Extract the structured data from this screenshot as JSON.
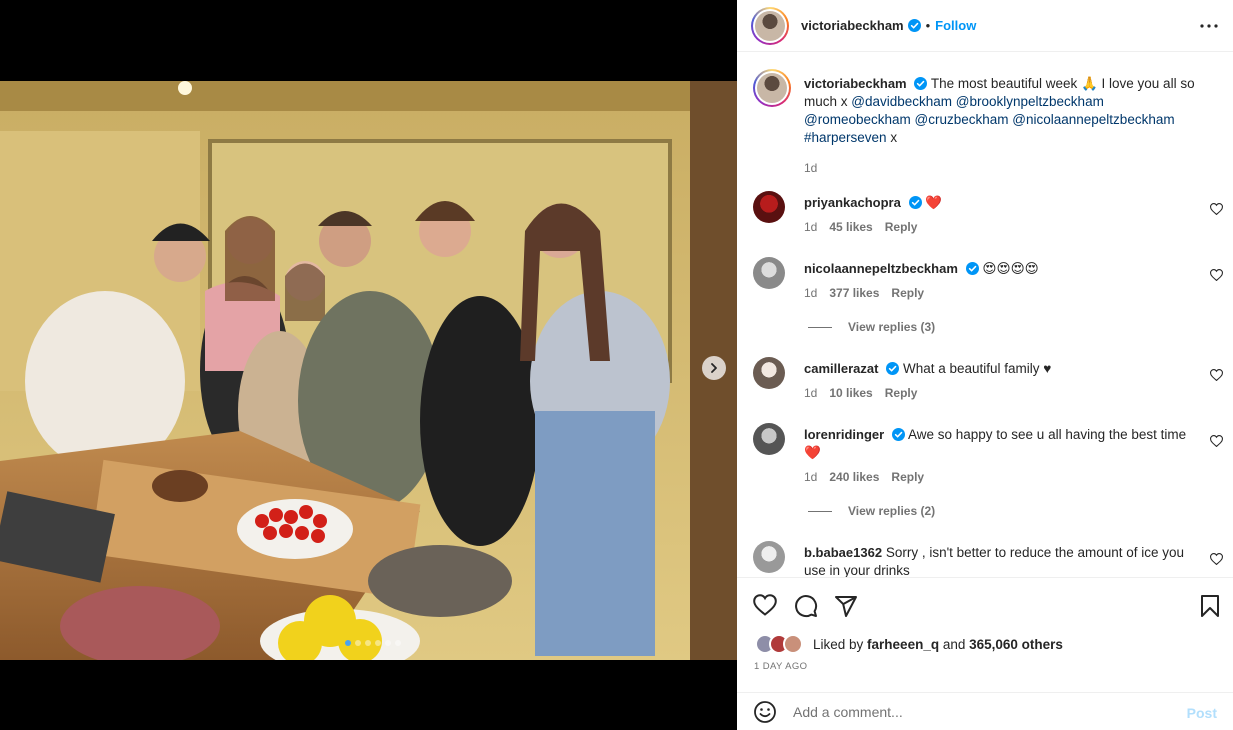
{
  "post": {
    "author": "victoriabeckham",
    "follow_label": "Follow",
    "separator": "•"
  },
  "caption": {
    "username": "victoriabeckham",
    "text_1": "The most beautiful week 🙏 I love you all so much x ",
    "mentions": [
      "@davidbeckham",
      "@brooklynpeltzbeckham",
      "@romeobeckham",
      "@cruzbeckham",
      "@nicolaannepeltzbeckham",
      "#harperseven"
    ],
    "text_end": " x",
    "time": "1d"
  },
  "comments": [
    {
      "username": "priyankachopra",
      "text": "❤️",
      "time": "1d",
      "likes": "45 likes",
      "reply": "Reply"
    },
    {
      "username": "nicolaannepeltzbeckham",
      "text": "😍😍😍😍",
      "time": "1d",
      "likes": "377 likes",
      "reply": "Reply",
      "view_replies": "View replies (3)"
    },
    {
      "username": "camillerazat",
      "text": "What a beautiful family ♥",
      "time": "1d",
      "likes": "10 likes",
      "reply": "Reply"
    },
    {
      "username": "lorenridinger",
      "text": "Awe so happy to see u all having the best time ❤️",
      "time": "1d",
      "likes": "240 likes",
      "reply": "Reply",
      "view_replies": "View replies (2)"
    },
    {
      "username": "b.babae1362",
      "text": "Sorry , isn't better to reduce the amount of ice you use in your drinks"
    }
  ],
  "likes": {
    "prefix": "Liked by ",
    "user": "farheeen_q",
    "middle": " and ",
    "count": "365,060 others"
  },
  "posted": "1 DAY AGO",
  "composer": {
    "placeholder": "Add a comment...",
    "post_label": "Post"
  },
  "carousel": {
    "slides": 6,
    "active": 1
  },
  "colors": {
    "link": "#0095f6",
    "mention": "#00376b",
    "muted": "#737373",
    "heart": "#ed4956"
  }
}
